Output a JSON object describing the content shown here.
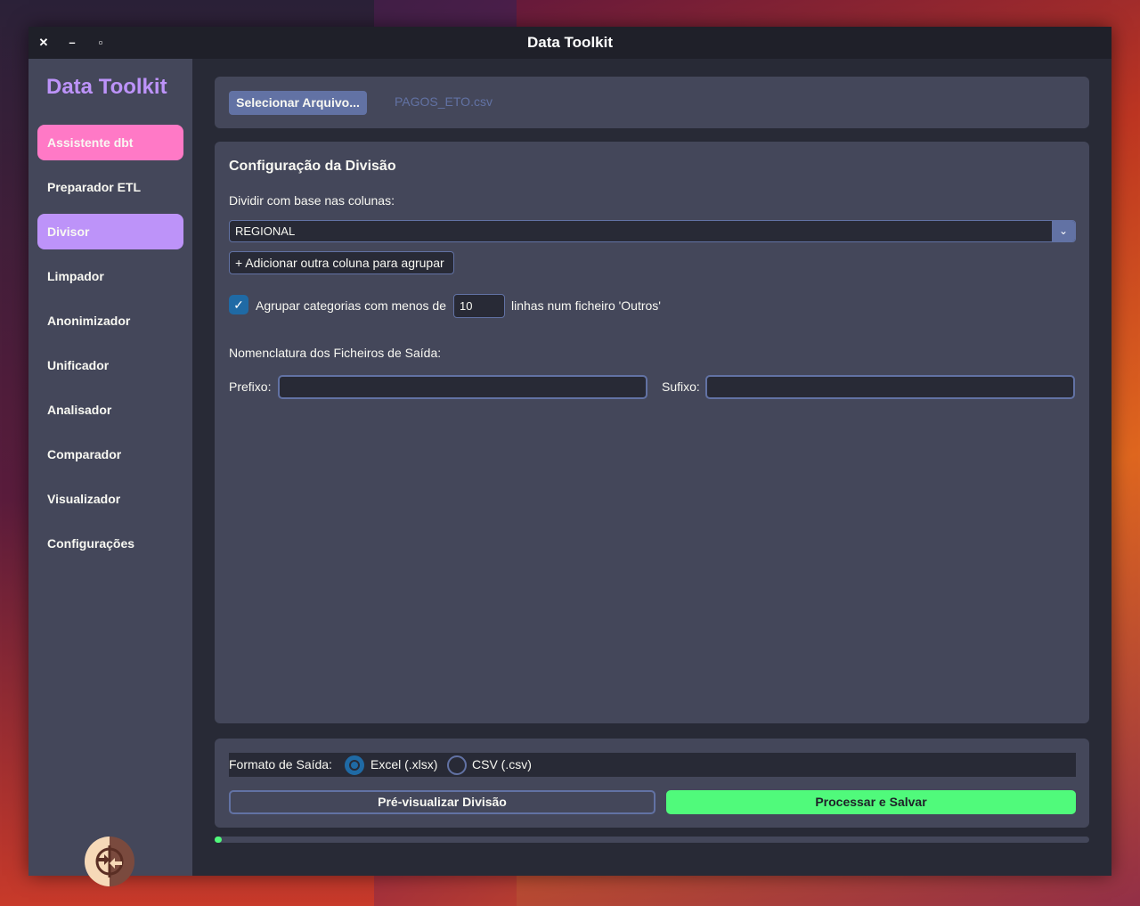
{
  "window": {
    "title": "Data Toolkit",
    "close_glyph": "✕",
    "minimize_glyph": "–",
    "maximize_glyph": "▫"
  },
  "sidebar": {
    "brand": "Data Toolkit",
    "items": [
      {
        "label": "Assistente dbt",
        "bg": "#ff79c6"
      },
      {
        "label": "Preparador ETL",
        "bg": ""
      },
      {
        "label": "Divisor",
        "bg": "#bd93f9"
      },
      {
        "label": "Limpador",
        "bg": ""
      },
      {
        "label": "Anonimizador",
        "bg": ""
      },
      {
        "label": "Unificador",
        "bg": ""
      },
      {
        "label": "Analisador",
        "bg": ""
      },
      {
        "label": "Comparador",
        "bg": ""
      },
      {
        "label": "Visualizador",
        "bg": ""
      },
      {
        "label": "Configurações",
        "bg": ""
      }
    ],
    "logo_icon": "split-arrows-logo-icon"
  },
  "file": {
    "select_label": "Selecionar Arquivo...",
    "filename": "PAGOS_ETO.csv"
  },
  "config": {
    "heading": "Configuração da Divisão",
    "split_columns_label": "Dividir com base nas colunas:",
    "column_value": "REGIONAL",
    "add_column_label": "+ Adicionar outra coluna para agrupar",
    "group_checkbox_checked": true,
    "group_prefix": "Agrupar categorias com menos de",
    "group_threshold": "10",
    "group_suffix": "linhas num ficheiro 'Outros'",
    "naming_heading": "Nomenclatura dos Ficheiros de Saída:",
    "prefix_label": "Prefixo:",
    "prefix_value": "",
    "suffix_label": "Sufixo:",
    "suffix_value": ""
  },
  "output": {
    "format_label": "Formato de Saída:",
    "options": [
      {
        "label": "Excel (.xlsx)",
        "selected": true
      },
      {
        "label": "CSV (.csv)",
        "selected": false
      }
    ],
    "preview_label": "Pré-visualizar Divisão",
    "process_label": "Processar e Salvar"
  },
  "progress": {
    "value": 0.008,
    "color": "#50fa7b"
  }
}
